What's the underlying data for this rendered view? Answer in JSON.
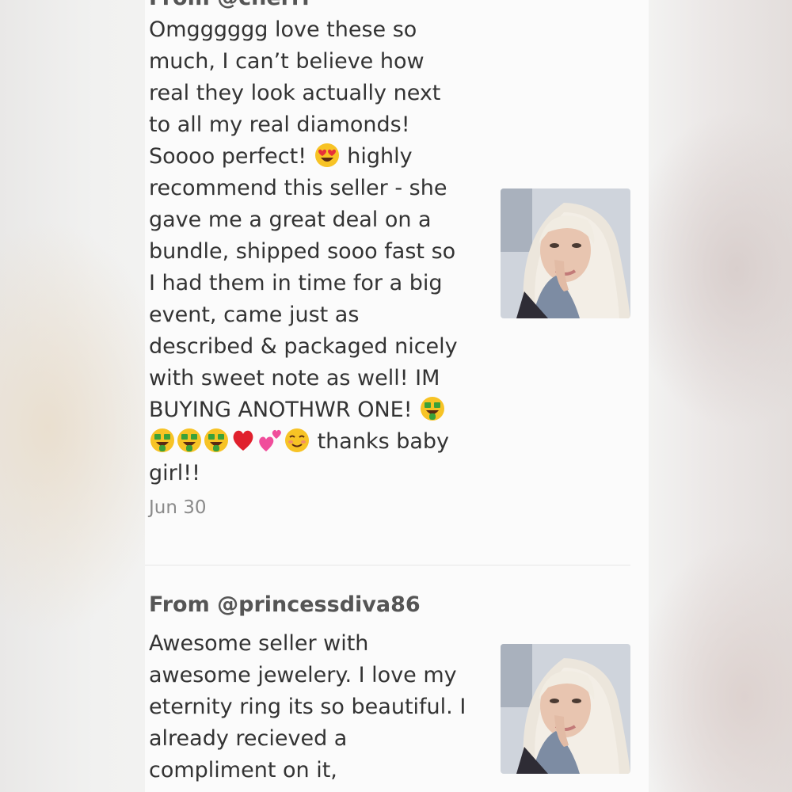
{
  "reviews": [
    {
      "author": "From @cherrr",
      "text_lines": [
        "Omgggggg love these so",
        "much, I can’t believe how",
        "real they look actually next",
        "to all my real diamonds!",
        "Soooo perfect!",
        "highly",
        "recommend this seller - she",
        "gave me a great deal on a",
        "bundle, shipped sooo fast so",
        "I had them in time for a big",
        "event, came just as",
        "described & packaged nicely",
        "with sweet note as well! IM",
        "BUYING ANOTHWR ONE!",
        "thanks baby",
        "girl!!"
      ],
      "date": "Jun 30",
      "emojis": [
        "heart-eyes-emoji",
        "money-mouth-emoji",
        "red-heart-emoji",
        "two-hearts-emoji",
        "smiling-blush-emoji"
      ]
    },
    {
      "author": "From @princessdiva86",
      "text_lines": [
        "Awesome seller with",
        "awesome jewelery. I love my",
        "eternity ring its so beautiful. I",
        "already recieved a",
        "compliment on it,"
      ]
    }
  ],
  "thumbnail_icon": "seller-avatar-photo",
  "colors": {
    "card_bg": "#fbfbfb",
    "text": "#333333",
    "author": "#555555",
    "date": "#8a8a8a"
  }
}
